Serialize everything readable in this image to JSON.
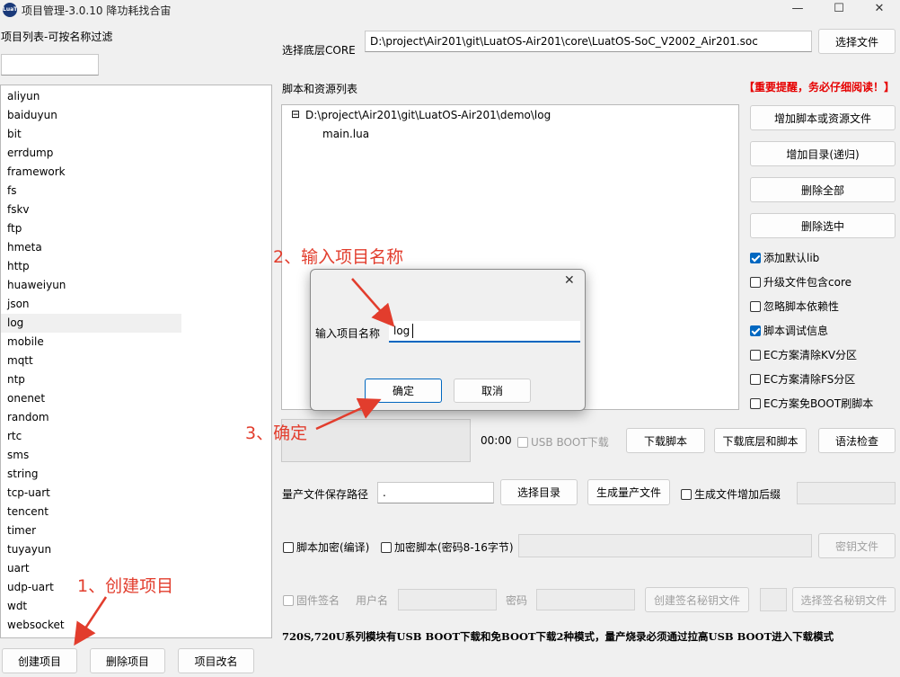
{
  "window": {
    "title": "项目管理-3.0.10 降功耗找合宙",
    "icon_text": "LuaT",
    "minimize": "—",
    "maximize": "☐",
    "close": "✕"
  },
  "left": {
    "filter_label": "项目列表-可按名称过滤",
    "filter_value": "",
    "projects": [
      "aliyun",
      "baiduyun",
      "bit",
      "errdump",
      "framework",
      "fs",
      "fskv",
      "ftp",
      "hmeta",
      "http",
      "huaweiyun",
      "json",
      "log",
      "mobile",
      "mqtt",
      "ntp",
      "onenet",
      "random",
      "rtc",
      "sms",
      "string",
      "tcp-uart",
      "tencent",
      "timer",
      "tuyayun",
      "uart",
      "udp-uart",
      "wdt",
      "websocket"
    ],
    "selected": "log",
    "create_button": "创建项目",
    "delete_button": "删除项目",
    "rename_button": "项目改名"
  },
  "core": {
    "label": "选择底层CORE",
    "path": "D:\\project\\Air201\\git\\LuatOS-Air201\\core\\LuatOS-SoC_V2002_Air201.soc",
    "select_button": "选择文件"
  },
  "scripts": {
    "label": "脚本和资源列表",
    "warning": "【重要提醒，务必仔细阅读！】",
    "tree_expander": "⊟",
    "tree_root": "D:\\project\\Air201\\git\\LuatOS-Air201\\demo\\log",
    "tree_child": "main.lua",
    "add_file_button": "增加脚本或资源文件",
    "add_dir_button": "增加目录(递归)",
    "delete_all_button": "删除全部",
    "delete_selected_button": "删除选中"
  },
  "options": [
    {
      "label": "添加默认lib",
      "checked": true
    },
    {
      "label": "升级文件包含core",
      "checked": false
    },
    {
      "label": "忽略脚本依赖性",
      "checked": false
    },
    {
      "label": "脚本调试信息",
      "checked": true
    },
    {
      "label": "EC方案清除KV分区",
      "checked": false
    },
    {
      "label": "EC方案清除FS分区",
      "checked": false
    },
    {
      "label": "EC方案免BOOT刷脚本",
      "checked": false
    }
  ],
  "download": {
    "time": "00:00",
    "usb_boot_label": "USB BOOT下载",
    "download_script_button": "下载脚本",
    "download_all_button": "下载底层和脚本",
    "syntax_check_button": "语法检查"
  },
  "mass": {
    "path_label": "量产文件保存路径",
    "path_value": ".",
    "select_dir_button": "选择目录",
    "generate_button": "生成量产文件",
    "suffix_label": "生成文件增加后缀"
  },
  "encrypt": {
    "compile_label": "脚本加密(编译)",
    "encrypt_label": "加密脚本(密码8-16字节)",
    "key_button": "密钥文件"
  },
  "sign": {
    "firmware_label": "固件签名",
    "user_label": "用户名",
    "password_label": "密码",
    "create_key_button": "创建签名秘钥文件",
    "select_key_button": "选择签名秘钥文件"
  },
  "note": "720S,720U系列模块有USB BOOT下载和免BOOT下载2种模式，量产烧录必须通过拉高USB BOOT进入下载模式",
  "dialog": {
    "close": "✕",
    "label": "输入项目名称",
    "value": "log",
    "ok_button": "确定",
    "cancel_button": "取消"
  },
  "annotations": {
    "step1": "1、创建项目",
    "step2": "2、输入项目名称",
    "step3": "3、确定",
    "color": "#e23d2d"
  }
}
